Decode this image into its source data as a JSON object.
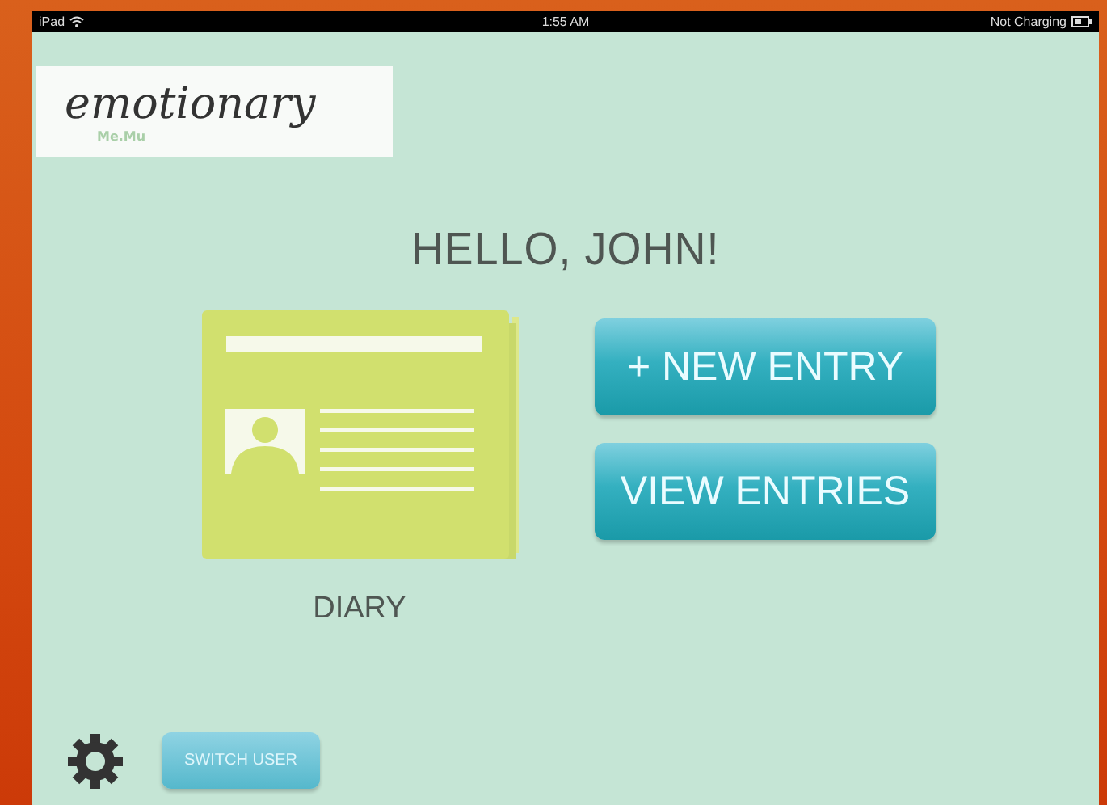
{
  "status_bar": {
    "device": "iPad",
    "time": "1:55 AM",
    "battery": "Not Charging"
  },
  "logo": {
    "title": "emotionary",
    "subtitle": "Me.Mu"
  },
  "greeting": "HELLO, JOHN!",
  "diary": {
    "label": "DIARY"
  },
  "actions": [
    {
      "label": "+ NEW ENTRY"
    },
    {
      "label": "VIEW ENTRIES"
    }
  ],
  "footer": {
    "switch_user": "SWITCH USER"
  }
}
